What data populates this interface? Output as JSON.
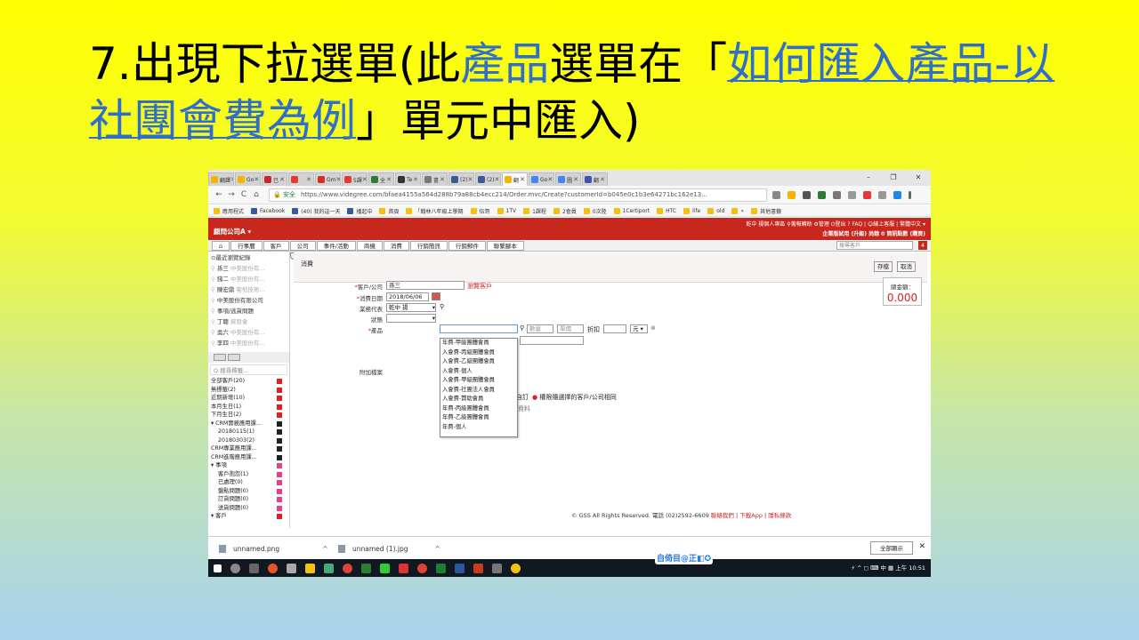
{
  "slide": {
    "title_p1": "7.出現下拉選單(此",
    "title_p2": "產品",
    "title_p3": "選單在「",
    "title_link": "如何匯入產品-以社團會費為例",
    "title_p4": "」單元中匯入)"
  },
  "browser": {
    "tabs": [
      "翻譯",
      "Go",
      "已",
      "",
      "Gm",
      "5課",
      "全",
      "Te",
      "書",
      "(2)",
      "(2)",
      "翻",
      "Go",
      "圖",
      "翻"
    ],
    "window_controls": [
      "–",
      "❐",
      "✕"
    ],
    "nav": [
      "←",
      "→",
      "C",
      "⌂"
    ],
    "secure_label": "安全",
    "url": "https://www.videgree.com/bfaea4155a564d288b79a88cb4ecc214/Order.mvc/Create?customerId=b045e0c1b3e64271bc162e13...",
    "bookmarks": [
      "應用程式",
      "Facebook",
      "(40) 我的這一天",
      "播起中",
      "首頁",
      "「翰林八年級上學期",
      "伍哥",
      "1TV",
      "1課程",
      "2會員",
      "0次陸",
      "1Certiport",
      "HTC",
      "life",
      "old",
      "»",
      "其他書籤"
    ]
  },
  "app": {
    "company": "顧問公司A ▾",
    "header_right_1": "乾中 揚個人專區 ⚲蒐報轉助 ⚙管理 ⏻登出 ? FAQ | ☺線上客服 | 繁體中文 ▾",
    "header_right_2": "企業版試用 (升級) 尚餘 0 筒訊點數 (購買)",
    "menu": [
      "⌂",
      "行事曆",
      "客戶",
      "公司",
      "事件/活動",
      "商機",
      "消費",
      "行銷簡訊",
      "行銷郵件",
      "聯繫腳本"
    ],
    "search_placeholder": "搜尋客戶",
    "notification_count": "4",
    "left": {
      "recent_title": "⊙最近瀏覽紀錄",
      "recent": [
        {
          "name": "孫三",
          "sub": "中美股份有..."
        },
        {
          "name": "錢二",
          "sub": "中美股份有..."
        },
        {
          "name": "陳宏鼎",
          "sub": "葡萄技術..."
        },
        {
          "name": "中美股份有限公司",
          "sub": ""
        },
        {
          "name": "事項/逃貨問題",
          "sub": ""
        },
        {
          "name": "丁聰",
          "sub": "資發會"
        },
        {
          "name": "吳六",
          "sub": "中美股份有..."
        },
        {
          "name": "李四",
          "sub": "中美股份有..."
        }
      ],
      "tag_search": "Q 搜尋標籤...",
      "tags": [
        {
          "label": "全部客戶(20)",
          "level": 0,
          "color": "red"
        },
        {
          "label": "無標籤(2)",
          "level": 0,
          "color": "red"
        },
        {
          "label": "近期新增(10)",
          "level": 0,
          "color": "red"
        },
        {
          "label": "本月生日(1)",
          "level": 0,
          "color": "red"
        },
        {
          "label": "下月生日(2)",
          "level": 0,
          "color": "red"
        },
        {
          "label": "▾ CRM實務應用課...",
          "level": 0,
          "color": "black"
        },
        {
          "label": "20180115(1)",
          "level": 1,
          "color": "black"
        },
        {
          "label": "20180303(2)",
          "level": 1,
          "color": "black"
        },
        {
          "label": "CRM專業應用課...",
          "level": 0,
          "color": "black"
        },
        {
          "label": "CRM進階應用課...",
          "level": 0,
          "color": "black"
        },
        {
          "label": "▾ 事項",
          "level": 0,
          "color": "magenta"
        },
        {
          "label": "客戶抱怨(1)",
          "level": 1,
          "color": "magenta"
        },
        {
          "label": "已處理(0)",
          "level": 1,
          "color": "magenta"
        },
        {
          "label": "盤點問題(0)",
          "level": 1,
          "color": "magenta"
        },
        {
          "label": "訂貨問題(0)",
          "level": 1,
          "color": "magenta"
        },
        {
          "label": "送貨問題(0)",
          "level": 1,
          "color": "magenta"
        },
        {
          "label": "▾ 客戶",
          "level": 0,
          "color": "red"
        }
      ]
    },
    "form": {
      "panel_title": "消費",
      "save": "存檔",
      "cancel": "取消",
      "customer_label": "客戶/公司",
      "customer_value": "孫三",
      "customer_link": "瀏覽客戶",
      "date_label": "消費日期",
      "date_value": "2018/06/06",
      "rep_label": "業務代表",
      "rep_value": "乾中 揚",
      "status_label": "狀態",
      "product_label": "產品",
      "qty_placeholder": "數量",
      "price_placeholder": "單價",
      "discount_label": "折扣",
      "currency": "元",
      "attach_label": "附加檔案",
      "privacy_left": "自訂",
      "privacy_right": "權限隨選擇的客戶/公司相同",
      "more_text": "資料",
      "total_label": "總金額：",
      "total_value": "0.000",
      "dropdown_options": [
        "年費-甲級團體會員",
        "入會費-丙級團體會員",
        "入會費-乙級團體會員",
        "入會費-個人",
        "入會費-甲級團體會員",
        "入會費-社團法人會員",
        "入會費-贊助會員",
        "年費-丙級團體會員",
        "年費-乙級團體會員",
        "年費-個人"
      ]
    },
    "footer_text": "© GSS All Rights Reserved. 電話 (02)2592-6609",
    "footer_links": [
      "聯絡我們",
      "下載App",
      "隱私條款"
    ]
  },
  "downloads": {
    "items": [
      "unnamed.png",
      "unnamed (1).jpg"
    ],
    "show_all": "全部顯示"
  },
  "taskbar": {
    "ime": "自倚目@正◧✪",
    "tray": "⚡ ^ ◻ ⌨ 中 ▦  上午 10:51"
  }
}
